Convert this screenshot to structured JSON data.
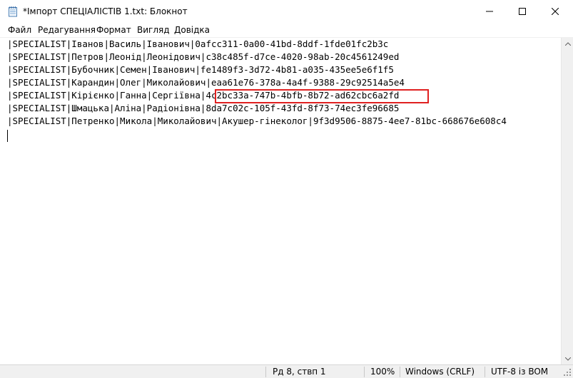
{
  "window": {
    "title": "*Імпорт СПЕЦІАЛІСТІВ 1.txt: Блокнот",
    "app_icon": "notepad-icon"
  },
  "menu": {
    "items": [
      {
        "label": "Файл"
      },
      {
        "label": "Редагування"
      },
      {
        "label": "Формат"
      },
      {
        "label": "Вигляд"
      },
      {
        "label": "Довідка"
      }
    ]
  },
  "document": {
    "lines": [
      "|SPECIALIST|Іванов|Василь|Іванович|0afcc311-0a00-41bd-8ddf-1fde01fc2b3c",
      "|SPECIALIST|Петров|Леонід|Леонідович|c38c485f-d7ce-4020-98ab-20c4561249ed",
      "|SPECIALIST|Бубочник|Семен|Іванович|fe1489f3-3d72-4b81-a035-435ee5e6f1f5",
      "|SPECIALIST|Карандин|Олег|Миколайович|eaa61e76-378a-4a4f-9388-29c92514a5e4",
      "|SPECIALIST|Кірієнко|Ганна|Сергіївна|4c2bc33a-747b-4bfb-8b72-ad62cbc6a2fd",
      "|SPECIALIST|Шмацька|Аліна|Радіонівна|8da7c02c-105f-43fd-8f73-74ec3fe96685",
      "|SPECIALIST|Петренко|Микола|Миколайович|Акушер-гінеколог|9f3d9506-8875-4ee7-81bc-668676e608c4"
    ],
    "highlight_color": "#e02020"
  },
  "status": {
    "position": "Рд 8, ствп 1",
    "zoom": "100%",
    "line_ending": "Windows (CRLF)",
    "encoding": "UTF-8 із BOM"
  }
}
